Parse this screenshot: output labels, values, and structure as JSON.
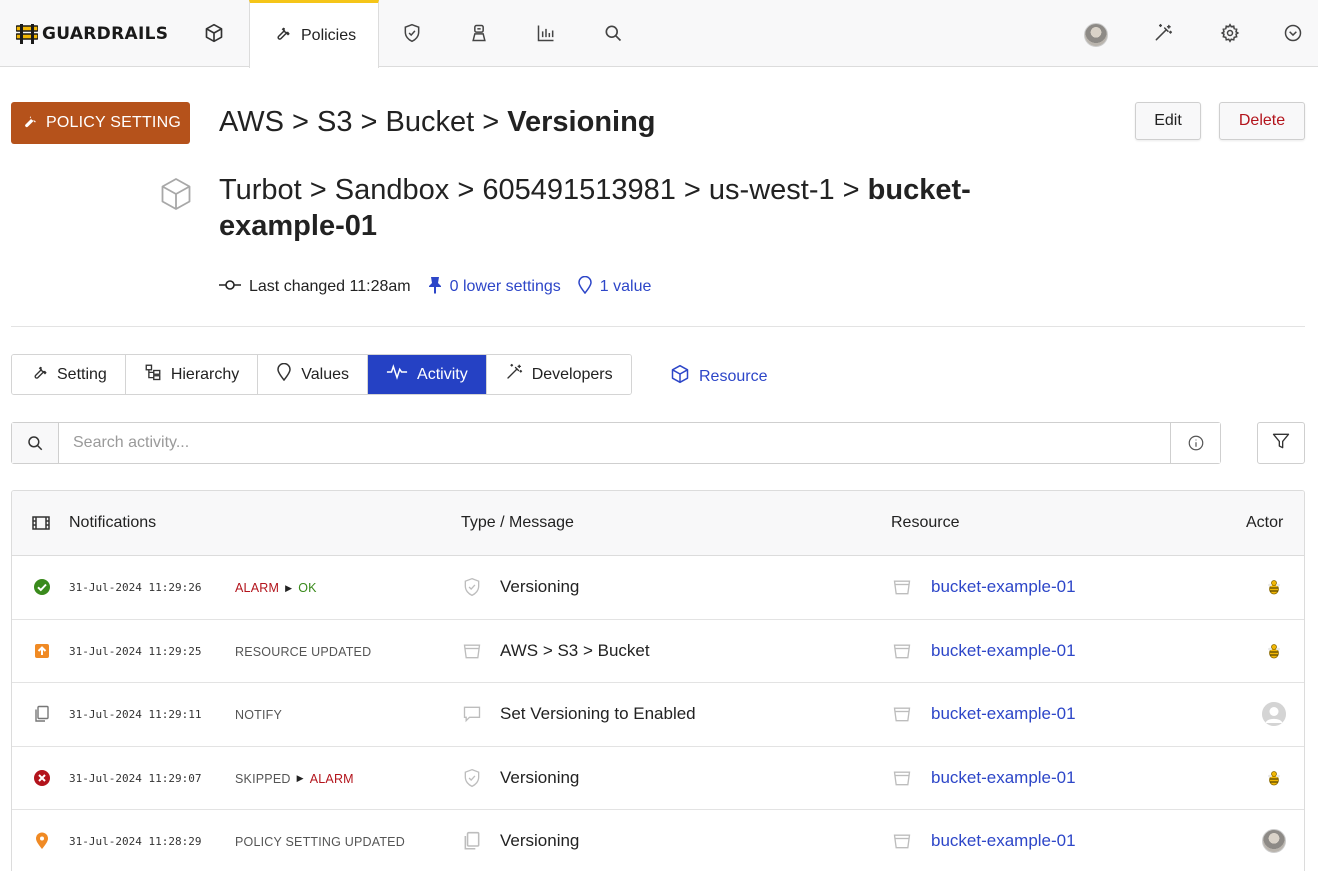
{
  "app": {
    "name": "GUARDRAILS"
  },
  "topnav": {
    "active_tab_label": "Policies",
    "icons": [
      "cube-icon",
      "wrench-icon",
      "shield-check-icon",
      "bot-icon",
      "bar-chart-icon",
      "search-icon",
      "avatar",
      "magic-wand-icon",
      "gear-icon",
      "chevron-down-circle-icon"
    ]
  },
  "header": {
    "badge_label": "POLICY SETTING",
    "policy_path_prefix": "AWS > S3 > Bucket > ",
    "policy_name": "Versioning",
    "resource_path_prefix": "Turbot > Sandbox > 605491513981 > us-west-1 > ",
    "resource_name": "bucket-example-01",
    "edit_label": "Edit",
    "delete_label": "Delete"
  },
  "meta": {
    "last_changed": "Last changed 11:28am",
    "lower_settings": "0 lower settings",
    "values": "1 value"
  },
  "tabs": [
    {
      "label": "Setting",
      "icon": "wrench-icon",
      "active": false
    },
    {
      "label": "Hierarchy",
      "icon": "hierarchy-icon",
      "active": false
    },
    {
      "label": "Values",
      "icon": "pin-outline-icon",
      "active": false
    },
    {
      "label": "Activity",
      "icon": "activity-icon",
      "active": true
    },
    {
      "label": "Developers",
      "icon": "magic-wand-icon",
      "active": false
    }
  ],
  "resource_link": "Resource",
  "search": {
    "placeholder": "Search activity..."
  },
  "table": {
    "headers": {
      "notifications": "Notifications",
      "type_message": "Type / Message",
      "resource": "Resource",
      "actor": "Actor"
    },
    "rows": [
      {
        "status": "ok",
        "time": "31-Jul-2024 11:29:26",
        "type_from": "ALARM",
        "type_to": "OK",
        "type": "",
        "msg_icon": "shield-icon",
        "message": "Versioning",
        "resource": "bucket-example-01",
        "actor": "bee"
      },
      {
        "status": "updated",
        "time": "31-Jul-2024 11:29:25",
        "type_from": "",
        "type_to": "",
        "type": "RESOURCE UPDATED",
        "msg_icon": "bucket-icon",
        "message": "AWS > S3 > Bucket",
        "resource": "bucket-example-01",
        "actor": "bee"
      },
      {
        "status": "notify",
        "time": "31-Jul-2024 11:29:11",
        "type_from": "",
        "type_to": "",
        "type": "NOTIFY",
        "msg_icon": "comment-icon",
        "message": "Set Versioning to Enabled",
        "resource": "bucket-example-01",
        "actor": "anon"
      },
      {
        "status": "error",
        "time": "31-Jul-2024 11:29:07",
        "type_from": "SKIPPED",
        "type_to": "ALARM",
        "type": "",
        "msg_icon": "shield-icon",
        "message": "Versioning",
        "resource": "bucket-example-01",
        "actor": "bee"
      },
      {
        "status": "pin",
        "time": "31-Jul-2024 11:28:29",
        "type_from": "",
        "type_to": "",
        "type": "POLICY SETTING UPDATED",
        "msg_icon": "copy-icon",
        "message": "Versioning",
        "resource": "bucket-example-01",
        "actor": "photo"
      }
    ]
  },
  "colors": {
    "brand_badge": "#b5521b",
    "active_tab": "#2541c4",
    "link": "#2d46c8",
    "alarm": "#b3141c",
    "ok": "#3a8a1c",
    "nav_accent": "#f5c518"
  }
}
